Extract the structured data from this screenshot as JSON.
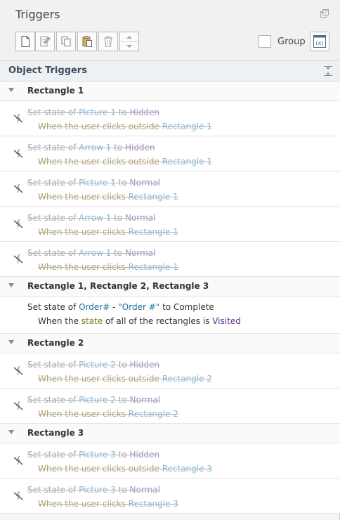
{
  "panel": {
    "title": "Triggers"
  },
  "toolbar": {
    "group_label": "Group"
  },
  "section": {
    "title": "Object Triggers"
  },
  "groups": [
    {
      "title": "Rectangle 1",
      "triggers": [
        {
          "l1": [
            "Set state of ",
            "Picture 1",
            " to ",
            "Hidden"
          ],
          "l2": [
            "When the user clicks outside ",
            "Rectangle 1"
          ]
        },
        {
          "l1": [
            "Set state of ",
            "Arrow 1",
            " to ",
            "Hidden"
          ],
          "l2": [
            "When the user clicks outside ",
            "Rectangle 1"
          ]
        },
        {
          "l1": [
            "Set state of ",
            "Picture 1",
            " to ",
            "Normal"
          ],
          "l2": [
            "When the user clicks ",
            "Rectangle 1"
          ]
        },
        {
          "l1": [
            "Set state of ",
            "Arrow 1",
            " to ",
            "Normal"
          ],
          "l2": [
            "When the user clicks ",
            "Rectangle 1"
          ]
        },
        {
          "l1": [
            "Set state of ",
            "Arrow 1",
            " to ",
            "Normal"
          ],
          "l2": [
            "When the user clicks ",
            "Rectangle 1"
          ]
        }
      ]
    },
    {
      "title": "Rectangle 1, Rectangle 2, Rectangle 3",
      "active_trigger": {
        "l1": [
          "Set state of ",
          "Order#",
          " - ",
          "\"Order #\"",
          " to ",
          "Complete"
        ],
        "l2": [
          "When the ",
          "state",
          " of all of the rectangles is ",
          "Visited"
        ]
      }
    },
    {
      "title": "Rectangle 2",
      "triggers": [
        {
          "l1": [
            "Set state of ",
            "Picture 2",
            " to ",
            "Hidden"
          ],
          "l2": [
            "When the user clicks outside ",
            "Rectangle 2"
          ]
        },
        {
          "l1": [
            "Set state of ",
            "Picture 2",
            " to ",
            "Normal"
          ],
          "l2": [
            "When the user clicks ",
            "Rectangle 2"
          ]
        }
      ]
    },
    {
      "title": "Rectangle 3",
      "triggers": [
        {
          "l1": [
            "Set state of ",
            "Picture 3",
            " to ",
            "Hidden"
          ],
          "l2": [
            "When the user clicks outside ",
            "Rectangle 3"
          ]
        },
        {
          "l1": [
            "Set state of ",
            "Picture 3",
            " to ",
            "Normal"
          ],
          "l2": [
            "When the user clicks ",
            "Rectangle 3"
          ]
        }
      ]
    }
  ],
  "icons": [
    "restore-icon",
    "new-trigger-icon",
    "edit-trigger-icon",
    "copy-icon",
    "paste-icon",
    "delete-icon",
    "move-up-icon",
    "move-down-icon",
    "variables-icon",
    "collapse-all-icon",
    "trigger-disabled-icon",
    "expand-triangle-icon"
  ]
}
